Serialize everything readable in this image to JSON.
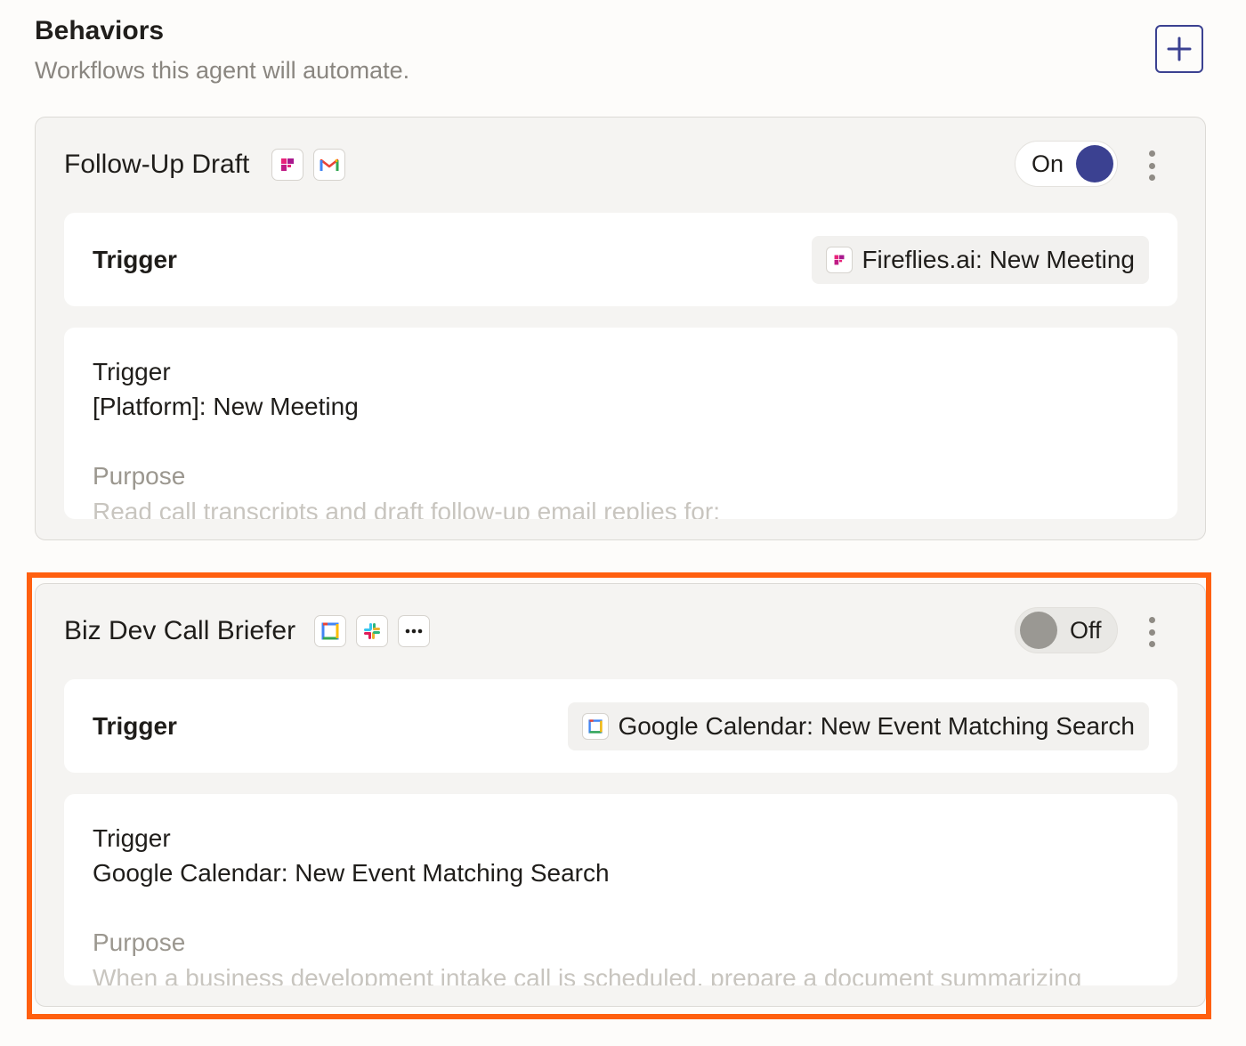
{
  "header": {
    "title": "Behaviors",
    "subtitle": "Workflows this agent will automate."
  },
  "behaviors": [
    {
      "title": "Follow-Up Draft",
      "apps": [
        "fireflies-icon",
        "gmail-icon"
      ],
      "toggle": "On",
      "trigger_label": "Trigger",
      "trigger_app": "Fireflies.ai: New Meeting",
      "detail_trigger_heading": "Trigger",
      "detail_trigger_value": "[Platform]: New Meeting",
      "purpose_heading": "Purpose",
      "purpose_text": "Read call transcripts and draft follow-up email replies for:"
    },
    {
      "title": "Biz Dev Call Briefer",
      "apps": [
        "google-calendar-icon",
        "slack-icon",
        "more-apps-icon"
      ],
      "toggle": "Off",
      "trigger_label": "Trigger",
      "trigger_app": "Google Calendar: New Event Matching Search",
      "detail_trigger_heading": "Trigger",
      "detail_trigger_value": "Google Calendar: New Event Matching Search",
      "purpose_heading": "Purpose",
      "purpose_text": "When a business development intake call is scheduled, prepare a document summarizing"
    }
  ],
  "colors": {
    "accent": "#3b4191",
    "highlight": "#ff5f0f",
    "toggle_off": "#9a9893"
  }
}
